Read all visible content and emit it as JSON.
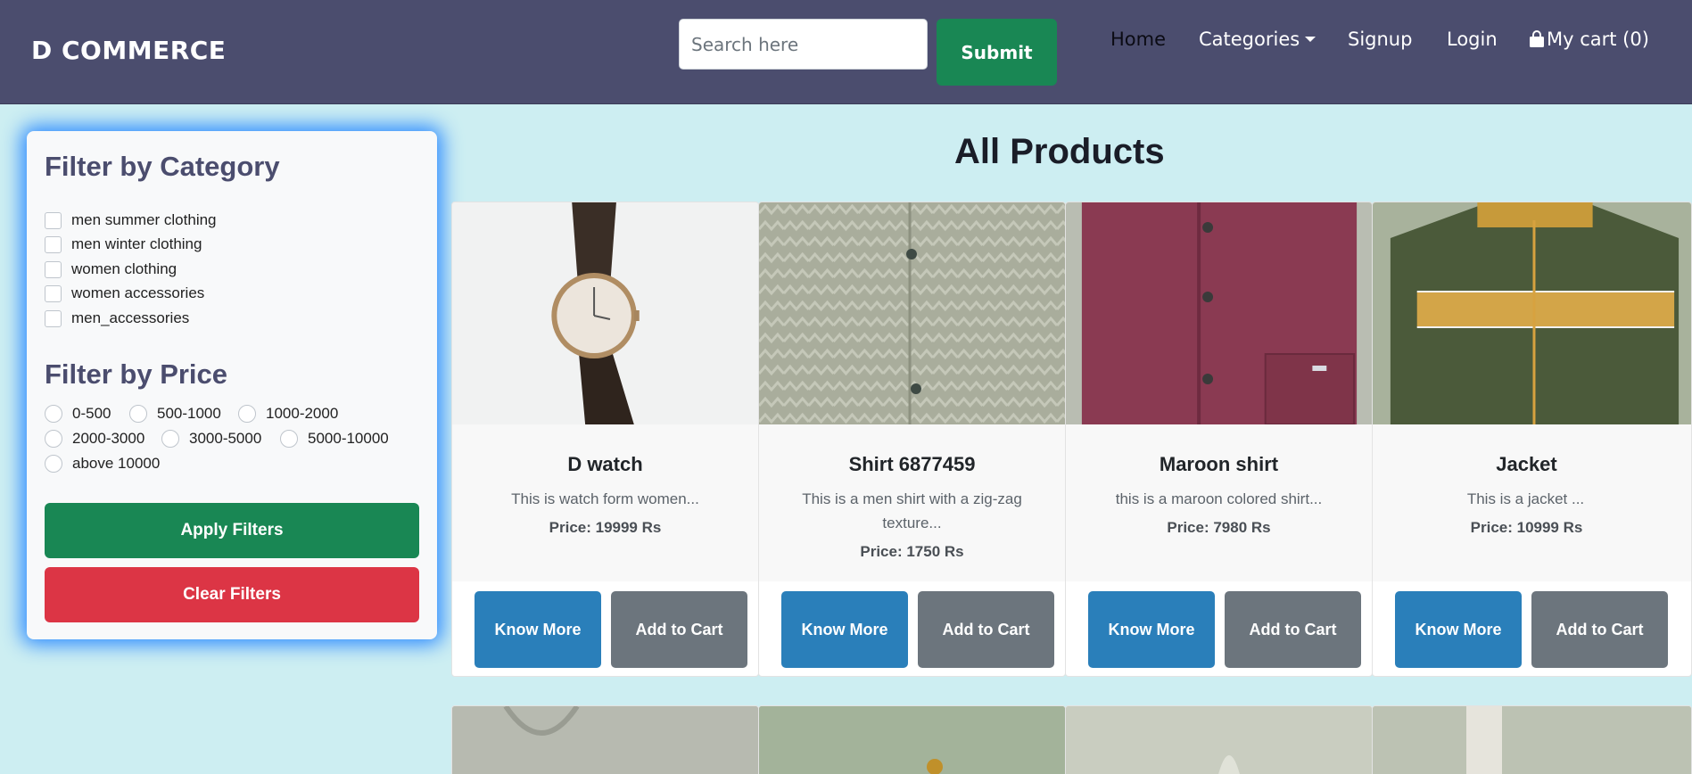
{
  "navbar": {
    "brand": "D COMMERCE",
    "search_placeholder": "Search here",
    "submit_label": "Submit",
    "links": {
      "home": "Home",
      "categories": "Categories",
      "signup": "Signup",
      "login": "Login",
      "cart": "My cart (0)"
    }
  },
  "filters": {
    "category_title": "Filter by Category",
    "categories": [
      "men summer clothing",
      "men winter clothing",
      "women clothing",
      "women accessories",
      "men_accessories"
    ],
    "price_title": "Filter by Price",
    "prices": [
      "0-500",
      "500-1000",
      "1000-2000",
      "2000-3000",
      "3000-5000",
      "5000-10000",
      "above 10000"
    ],
    "apply_label": "Apply Filters",
    "clear_label": "Clear Filters"
  },
  "products": {
    "title": "All Products",
    "know_more_label": "Know More",
    "add_to_cart_label": "Add to Cart",
    "items": [
      {
        "name": "D watch",
        "description": "This is watch form women...",
        "price": "Price: 19999 Rs"
      },
      {
        "name": "Shirt 6877459",
        "description": "This is a men shirt with a zig-zag texture...",
        "price": "Price: 1750 Rs"
      },
      {
        "name": "Maroon shirt",
        "description": "this is a maroon colored shirt...",
        "price": "Price: 7980 Rs"
      },
      {
        "name": "Jacket",
        "description": "This is a jacket ...",
        "price": "Price: 10999 Rs"
      }
    ]
  },
  "colors": {
    "navbar": "#4b4d6e",
    "page_background": "#cdeef2",
    "submit": "#198754",
    "apply": "#198754",
    "clear": "#dc3545",
    "know_more": "#2a7fba",
    "add_to_cart": "#6c757d",
    "filter_glow": "#2f8cff"
  }
}
